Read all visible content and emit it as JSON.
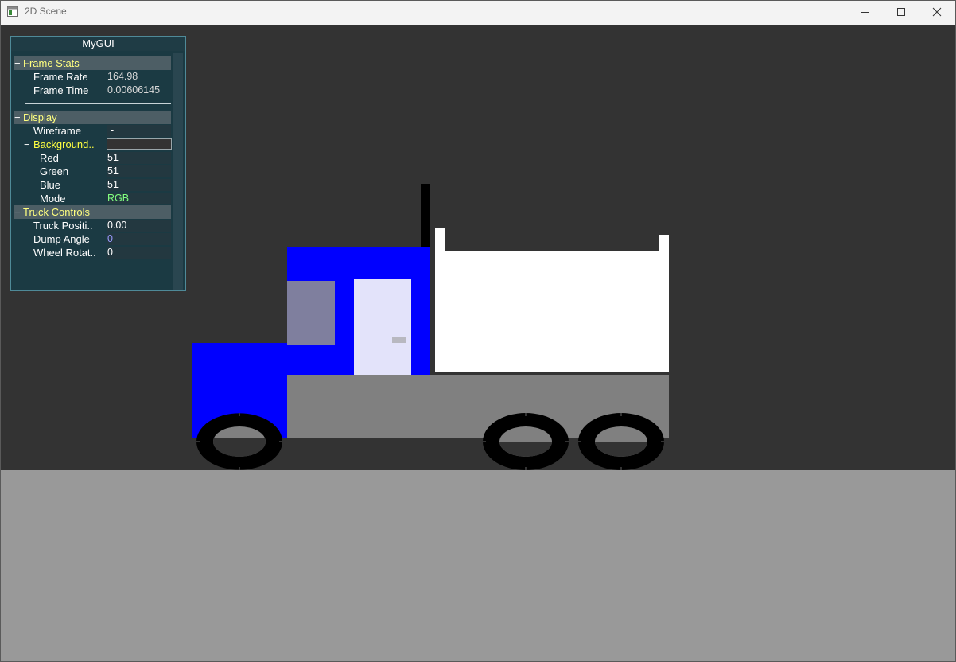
{
  "window": {
    "title": "2D Scene",
    "minimize_icon": "minimize-icon",
    "maximize_icon": "maximize-icon",
    "close_icon": "close-icon"
  },
  "scene": {
    "background_color": "#333333",
    "ground_color": "#999999",
    "cab_color": "#0000ff",
    "window_color": "#7f7f9e",
    "door_color": "#e3e3fa",
    "frame_color": "#808080",
    "bed_color": "#ffffff",
    "wheel_color": "#000000"
  },
  "gui": {
    "title": "MyGUI",
    "frame_stats": {
      "label": "Frame Stats",
      "toggle": "−",
      "frame_rate": {
        "label": "Frame Rate",
        "value": "164.98"
      },
      "frame_time": {
        "label": "Frame Time",
        "value": "0.00606145"
      }
    },
    "display": {
      "label": "Display",
      "toggle": "−",
      "wireframe": {
        "label": "Wireframe",
        "value": "-"
      },
      "background": {
        "label": "Background..",
        "toggle": "−",
        "swatch_color": "#333333",
        "red": {
          "label": "Red",
          "value": "51"
        },
        "green": {
          "label": "Green",
          "value": "51"
        },
        "blue": {
          "label": "Blue",
          "value": "51"
        },
        "mode": {
          "label": "Mode",
          "value": "RGB",
          "color": "#80ff80"
        }
      }
    },
    "truck_controls": {
      "label": "Truck Controls",
      "toggle": "−",
      "truck_position": {
        "label": "Truck Positi..",
        "value": "0.00"
      },
      "dump_angle": {
        "label": "Dump Angle",
        "value": "0",
        "color": "#9a9aff"
      },
      "wheel_rotation": {
        "label": "Wheel Rotat..",
        "value": "0"
      }
    }
  }
}
